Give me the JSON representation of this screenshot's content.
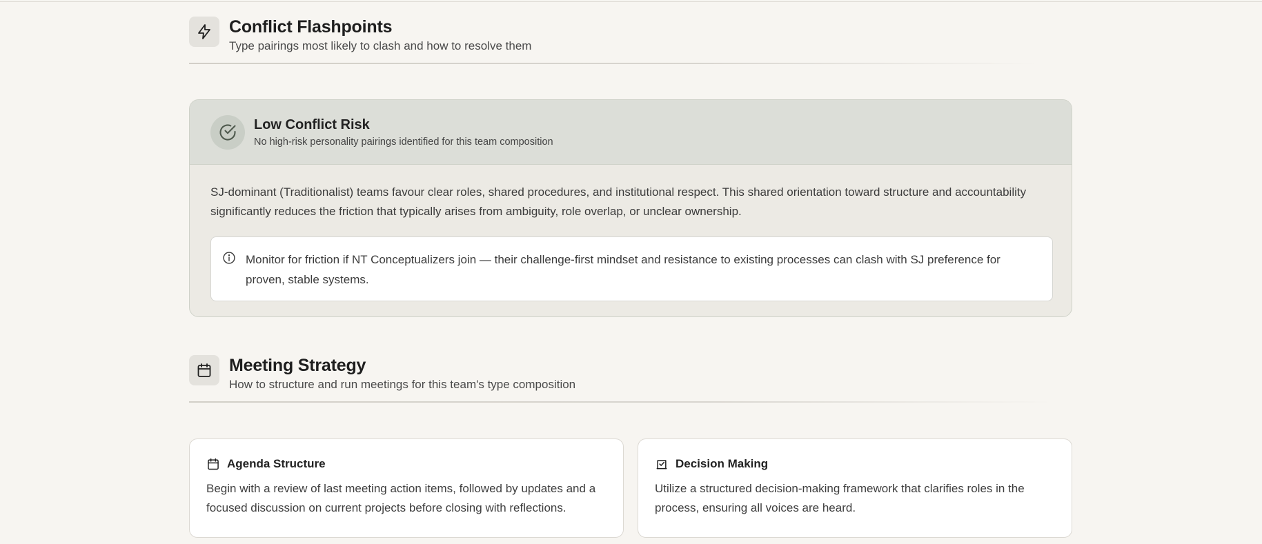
{
  "conflict_section": {
    "title": "Conflict Flashpoints",
    "subtitle": "Type pairings most likely to clash and how to resolve them",
    "icon": "lightning-icon"
  },
  "risk_card": {
    "title": "Low Conflict Risk",
    "subtitle": "No high-risk personality pairings identified for this team composition",
    "icon": "check-circle-icon",
    "description": "SJ-dominant (Traditionalist) teams favour clear roles, shared procedures, and institutional respect. This shared orientation toward structure and accountability significantly reduces the friction that typically arises from ambiguity, role overlap, or unclear ownership.",
    "note": {
      "icon": "info-icon",
      "text": "Monitor for friction if NT Conceptualizers join — their challenge-first mindset and resistance to existing processes can clash with SJ preference for proven, stable systems."
    }
  },
  "meeting_section": {
    "title": "Meeting Strategy",
    "subtitle": "How to structure and run meetings for this team's type composition",
    "icon": "calendar-icon"
  },
  "meeting_cards": [
    {
      "title": "Agenda Structure",
      "icon": "calendar-icon",
      "text": "Begin with a review of last meeting action items, followed by updates and a focused discussion on current projects before closing with reflections."
    },
    {
      "title": "Decision Making",
      "icon": "vote-box-icon",
      "text": "Utilize a structured decision-making framework that clarifies roles in the process, ensuring all voices are heard."
    }
  ]
}
